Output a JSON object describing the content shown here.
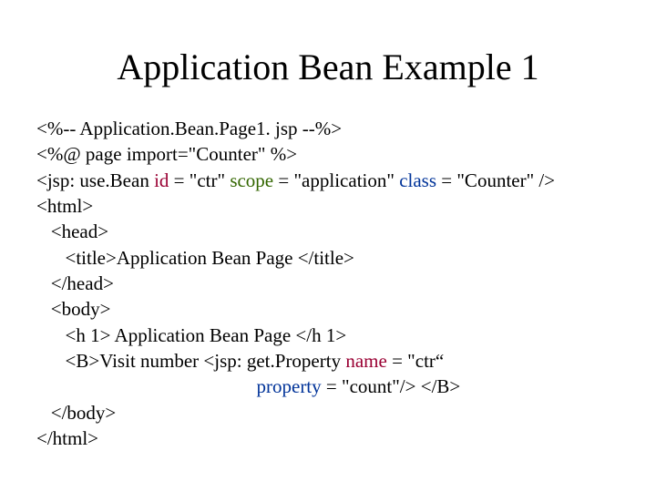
{
  "title": "Application Bean Example 1",
  "code": {
    "l1": "<%-- Application.Bean.Page1. jsp --%>",
    "l2": "<%@ page import=\"Counter\" %>",
    "l3a": "<jsp: use.Bean ",
    "l3_id": "id",
    "l3b": " = \"ctr\" ",
    "l3_scope": "scope",
    "l3c": " = \"application\" ",
    "l3_class": "class",
    "l3d": " = \"Counter\" />",
    "l4": "<html>",
    "l5": "   <head>",
    "l6": "      <title>Application Bean Page </title>",
    "l7": "   </head>",
    "l8": "   <body>",
    "l9": "      <h 1> Application Bean Page </h 1>",
    "l10a": "      <B>Visit number <jsp: get.Property ",
    "l10_name": "name",
    "l10b": " = \"ctr“",
    "l11a": "                                              ",
    "l11_prop": "property",
    "l11b": " = \"count\"/> </B>",
    "l12": "   </body>",
    "l13": "</html>"
  }
}
